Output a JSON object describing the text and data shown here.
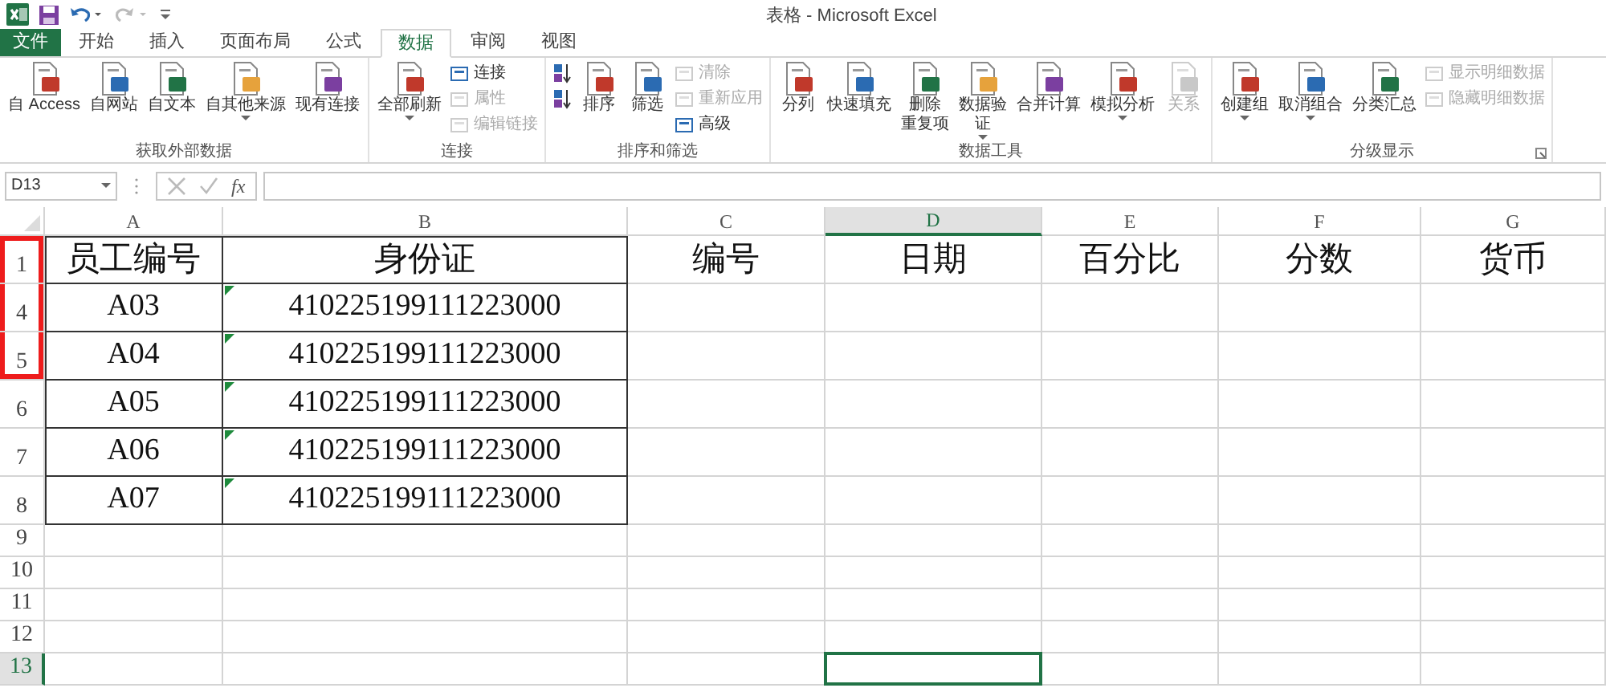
{
  "window": {
    "title": "表格 - Microsoft Excel"
  },
  "tabs": [
    {
      "label": "文件",
      "kind": "file",
      "selected": false
    },
    {
      "label": "开始",
      "kind": "tab",
      "selected": false
    },
    {
      "label": "插入",
      "kind": "tab",
      "selected": false
    },
    {
      "label": "页面布局",
      "kind": "tab",
      "selected": false
    },
    {
      "label": "公式",
      "kind": "tab",
      "selected": false
    },
    {
      "label": "数据",
      "kind": "tab",
      "selected": true
    },
    {
      "label": "审阅",
      "kind": "tab",
      "selected": false
    },
    {
      "label": "视图",
      "kind": "tab",
      "selected": false
    }
  ],
  "ribbon": [
    {
      "label": "获取外部数据",
      "launcher": false,
      "items": [
        {
          "kind": "large",
          "label": "自 Access",
          "disabled": false,
          "dropdown": false
        },
        {
          "kind": "large",
          "label": "自网站",
          "disabled": false,
          "dropdown": false
        },
        {
          "kind": "large",
          "label": "自文本",
          "disabled": false,
          "dropdown": false
        },
        {
          "kind": "large",
          "label": "自其他来源",
          "disabled": false,
          "dropdown": true
        },
        {
          "kind": "large",
          "label": "现有连接",
          "disabled": false,
          "dropdown": false
        }
      ]
    },
    {
      "label": "连接",
      "launcher": false,
      "items": [
        {
          "kind": "large",
          "label": "全部刷新",
          "disabled": false,
          "dropdown": true
        },
        {
          "kind": "small",
          "label": "连接",
          "disabled": false
        },
        {
          "kind": "small",
          "label": "属性",
          "disabled": true
        },
        {
          "kind": "small",
          "label": "编辑链接",
          "disabled": true
        }
      ]
    },
    {
      "label": "排序和筛选",
      "launcher": false,
      "items": [
        {
          "kind": "icon"
        },
        {
          "kind": "icon"
        },
        {
          "kind": "large",
          "label": "排序",
          "disabled": false,
          "dropdown": false
        },
        {
          "kind": "large",
          "label": "筛选",
          "disabled": false,
          "dropdown": false
        },
        {
          "kind": "small",
          "label": "清除",
          "disabled": true
        },
        {
          "kind": "small",
          "label": "重新应用",
          "disabled": true
        },
        {
          "kind": "small",
          "label": "高级",
          "disabled": false
        }
      ]
    },
    {
      "label": "数据工具",
      "launcher": false,
      "items": [
        {
          "kind": "large",
          "label": "分列",
          "disabled": false,
          "dropdown": false
        },
        {
          "kind": "large",
          "label": "快速填充",
          "disabled": false,
          "dropdown": false
        },
        {
          "kind": "large",
          "lines": [
            "删除",
            "重复项"
          ],
          "disabled": false,
          "dropdown": false
        },
        {
          "kind": "large",
          "lines": [
            "数据验",
            "证"
          ],
          "disabled": false,
          "dropdown": true
        },
        {
          "kind": "large",
          "label": "合并计算",
          "disabled": false,
          "dropdown": false
        },
        {
          "kind": "large",
          "label": "模拟分析",
          "disabled": false,
          "dropdown": true
        },
        {
          "kind": "large",
          "label": "关系",
          "disabled": true,
          "dropdown": false
        }
      ]
    },
    {
      "label": "分级显示",
      "launcher": true,
      "items": [
        {
          "kind": "large",
          "label": "创建组",
          "disabled": false,
          "dropdown": true
        },
        {
          "kind": "large",
          "label": "取消组合",
          "disabled": false,
          "dropdown": true
        },
        {
          "kind": "large",
          "label": "分类汇总",
          "disabled": false,
          "dropdown": false
        },
        {
          "kind": "small",
          "label": "显示明细数据",
          "disabled": true
        },
        {
          "kind": "small",
          "label": "隐藏明细数据",
          "disabled": true
        }
      ]
    }
  ],
  "formula_bar": {
    "name_box": "D13",
    "function_label": "fx"
  },
  "columns": [
    {
      "label": "A",
      "selected": false
    },
    {
      "label": "B",
      "selected": false
    },
    {
      "label": "C",
      "selected": false
    },
    {
      "label": "D",
      "selected": true
    },
    {
      "label": "E",
      "selected": false
    },
    {
      "label": "F",
      "selected": false
    },
    {
      "label": "G",
      "selected": false
    }
  ],
  "rows": [
    {
      "header": "1",
      "marked": true,
      "selected": false,
      "cells": [
        {
          "text": "员工编号",
          "boxed": true,
          "warning": false
        },
        {
          "text": "身份证",
          "boxed": true,
          "warning": false
        },
        {
          "text": "编号",
          "boxed": false,
          "warning": false
        },
        {
          "text": "日期",
          "boxed": false,
          "warning": false
        },
        {
          "text": "百分比",
          "boxed": false,
          "warning": false
        },
        {
          "text": "分数",
          "boxed": false,
          "warning": false
        },
        {
          "text": "货币",
          "boxed": false,
          "warning": false
        }
      ]
    },
    {
      "header": "4",
      "marked": true,
      "selected": false,
      "cells": [
        {
          "text": "A03",
          "boxed": true,
          "warning": false
        },
        {
          "text": "410225199111223000",
          "boxed": true,
          "warning": true
        }
      ]
    },
    {
      "header": "5",
      "marked": true,
      "selected": false,
      "cells": [
        {
          "text": "A04",
          "boxed": true,
          "warning": false
        },
        {
          "text": "410225199111223000",
          "boxed": true,
          "warning": true
        }
      ]
    },
    {
      "header": "6",
      "marked": false,
      "selected": false,
      "cells": [
        {
          "text": "A05",
          "boxed": true,
          "warning": false
        },
        {
          "text": "410225199111223000",
          "boxed": true,
          "warning": true
        }
      ]
    },
    {
      "header": "7",
      "marked": false,
      "selected": false,
      "cells": [
        {
          "text": "A06",
          "boxed": true,
          "warning": false
        },
        {
          "text": "410225199111223000",
          "boxed": true,
          "warning": true
        }
      ]
    },
    {
      "header": "8",
      "marked": false,
      "selected": false,
      "cells": [
        {
          "text": "A07",
          "boxed": true,
          "warning": false
        },
        {
          "text": "410225199111223000",
          "boxed": true,
          "warning": true
        }
      ]
    },
    {
      "header": "9",
      "marked": false,
      "selected": false,
      "cells": []
    },
    {
      "header": "10",
      "marked": false,
      "selected": false,
      "cells": []
    },
    {
      "header": "11",
      "marked": false,
      "selected": false,
      "cells": []
    },
    {
      "header": "12",
      "marked": false,
      "selected": false,
      "cells": []
    },
    {
      "header": "13",
      "marked": false,
      "selected": true,
      "cells": []
    }
  ]
}
